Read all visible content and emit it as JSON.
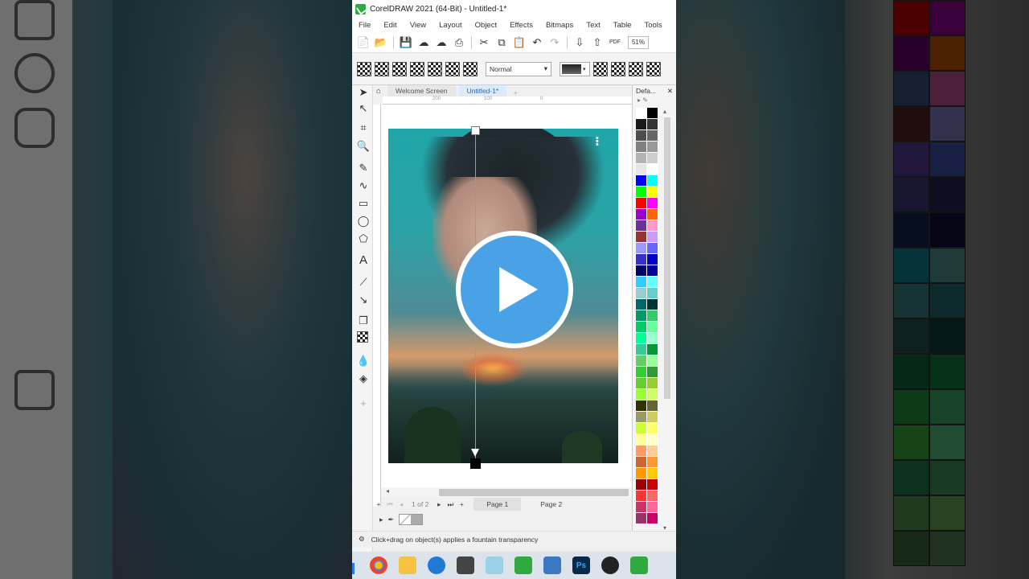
{
  "window": {
    "title": "CorelDRAW 2021 (64-Bit) - Untitled-1*"
  },
  "menu": [
    "File",
    "Edit",
    "View",
    "Layout",
    "Object",
    "Effects",
    "Bitmaps",
    "Text",
    "Table",
    "Tools"
  ],
  "toolbar": {
    "zoom": "51%",
    "pdf_label": "PDF"
  },
  "property_bar": {
    "merge_mode": "Normal"
  },
  "doc_tabs": [
    {
      "label": "Welcome Screen",
      "active": false
    },
    {
      "label": "Untitled-1*",
      "active": true
    }
  ],
  "rulers": {
    "h_ticks": [
      "200",
      "100",
      "0"
    ]
  },
  "pager": {
    "of_label": "of",
    "total": "2",
    "current": "1",
    "pages": [
      "Page 1",
      "Page 2"
    ]
  },
  "palette": {
    "title": "Defa..."
  },
  "status": {
    "hint": "Click+drag on object(s) applies a fountain transparency"
  },
  "colors": {
    "accent": "#2c6aa8",
    "play_button": "#4aa2e6",
    "app_icon": "#2eaa3e"
  },
  "palette_swatches": [
    "#ffffff",
    "#000000",
    "#1a1a1a",
    "#333333",
    "#4d4d4d",
    "#666666",
    "#808080",
    "#999999",
    "#b3b3b3",
    "#cccccc",
    "#e6e6e6",
    "#ffffff",
    "#0000ff",
    "#00ffff",
    "#00ff00",
    "#ffff00",
    "#ff0000",
    "#ff00ff",
    "#9900cc",
    "#ff6600",
    "#663399",
    "#ff99cc",
    "#993333",
    "#cc99ff",
    "#9999ff",
    "#6666ff",
    "#3333cc",
    "#0000cc",
    "#000066",
    "#000099",
    "#33ccff",
    "#66ffff",
    "#99cccc",
    "#66cccc",
    "#006666",
    "#003333",
    "#009966",
    "#33cc66",
    "#00cc66",
    "#66ff99",
    "#00ff99",
    "#99ffcc",
    "#33cc99",
    "#009933",
    "#66cc66",
    "#99ff99",
    "#33cc33",
    "#339933",
    "#66cc33",
    "#99cc33",
    "#99ff33",
    "#ccff66",
    "#333300",
    "#666633",
    "#999966",
    "#cccc66",
    "#ccff33",
    "#ffff66",
    "#ffff99",
    "#ffffcc",
    "#ff9966",
    "#ffcc99",
    "#cc6633",
    "#ff9933",
    "#ff9900",
    "#ffcc00",
    "#990000",
    "#cc0000",
    "#ff3333",
    "#ff6666",
    "#cc3366",
    "#ff6699",
    "#993366",
    "#cc0066"
  ],
  "taskbar": [
    "chrome",
    "files",
    "edge",
    "store",
    "notes",
    "coreldraw",
    "photos",
    "photoshop",
    "obs",
    "coreldraw-2"
  ]
}
